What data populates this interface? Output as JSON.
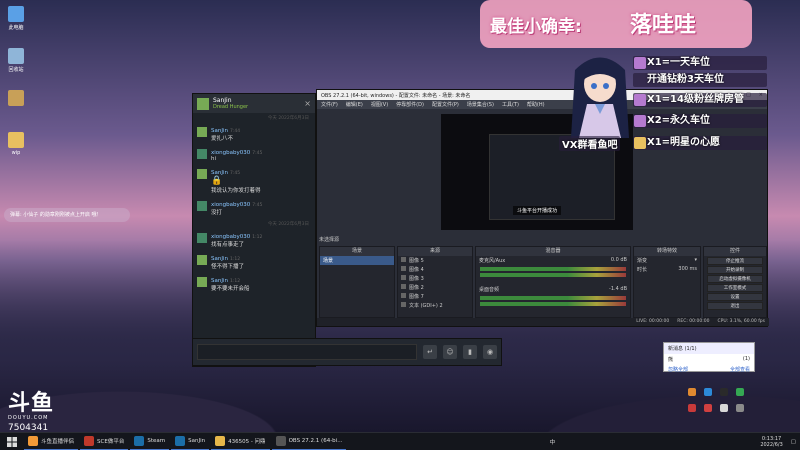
{
  "desktop": {
    "icons": [
      {
        "label": "此电脑",
        "color": "#5aa0e6"
      },
      {
        "label": "回收站",
        "color": "#8fb5d8"
      },
      {
        "label": "",
        "color": "#c8a058"
      },
      {
        "label": "wip",
        "color": "#e8c060"
      }
    ],
    "bubble_text": "弹幕: 小仙子 的勋章刚刚被点上开启 哦！"
  },
  "douyu": {
    "logo": "斗鱼",
    "sub": "DOUYU.COM",
    "room_number": "7504341"
  },
  "steam_chat": {
    "name": "SanJin",
    "game": "Dread Hunger",
    "messages": [
      {
        "sep": "今天 2022年6月3日",
        "who": "SanJin",
        "time": "7:44",
        "text": "爱扎八不",
        "color": "#7a5"
      },
      {
        "who": "xiongbaby030",
        "time": "7:45",
        "text": "hi",
        "color": "#486"
      },
      {
        "who": "SanJin",
        "time": "7:45",
        "text": "🔒",
        "color": "#7a5"
      },
      {
        "who": "",
        "time": "",
        "text": "我说认为你发打着得",
        "color": "#7a5"
      },
      {
        "who": "xiongbaby030",
        "time": "7:45",
        "text": "没打",
        "color": "#486"
      },
      {
        "sep": "今天 2022年6月3日",
        "who": "xiongbaby030",
        "time": "1:12",
        "text": "找有点事走了",
        "color": "#486"
      },
      {
        "who": "SanJin",
        "time": "1:12",
        "text": "怪不得下播了",
        "color": "#7a5"
      },
      {
        "who": "SanJin",
        "time": "1:12",
        "text": "要不要未开会船",
        "color": "#7a5"
      }
    ]
  },
  "obs": {
    "title": "OBS 27.2.1 (64-bit, windows) - 配置文件: 未命名 - 场景: 未命名",
    "menu": [
      "文件(F)",
      "编辑(E)",
      "视图(V)",
      "停靠部件(D)",
      "配置文件(P)",
      "场景集合(S)",
      "工具(T)",
      "帮助(H)"
    ],
    "preview_caption": "斗鱼平台开播成功",
    "panels_label": "未选择源",
    "scenes": {
      "title": "场景",
      "items": [
        "场景"
      ]
    },
    "sources": {
      "title": "来源",
      "items": [
        "图像 5",
        "图像 4",
        "图像 3",
        "图像 2",
        "图像 7",
        "文本 (GDI+) 2"
      ]
    },
    "mixer": {
      "title": "混音器",
      "tracks": [
        {
          "name": "麦克风/Aux",
          "db": "0.0 dB"
        },
        {
          "name": "桌面音频",
          "db": "-1.4 dB"
        }
      ]
    },
    "transitions": {
      "title": "转场特效",
      "type": "渐变",
      "duration_label": "时长",
      "duration": "300 ms"
    },
    "controls": {
      "title": "控件",
      "buttons": [
        "停止推流",
        "开始录制",
        "启动虚拟摄像机",
        "工作室模式",
        "设置",
        "退出"
      ]
    },
    "status": [
      "LIVE: 00:00:00",
      "REC: 00:00:00",
      "CPU: 3.1%, 60.00 fps"
    ]
  },
  "overlay": {
    "banner_text": "最佳小确幸:",
    "banner_name": "落哇哇",
    "ranks": [
      "X1=一天车位",
      "开通钻粉3天车位",
      "X1=14级粉丝牌房管",
      "X2=永久车位",
      "X1=明星の心愿"
    ],
    "vx_text": "VX群看鱼吧"
  },
  "notification": {
    "title": "新消息 (1/1)",
    "item": "熊",
    "count": "(1)",
    "footer_left": "忽略全部",
    "footer_right": "全部查看"
  },
  "taskbar": {
    "items": [
      {
        "label": "斗鱼直播伴侣",
        "color": "#f29a38"
      },
      {
        "label": "SCE做平台",
        "color": "#c0392b"
      },
      {
        "label": "Steam",
        "color": "#1b6ea8"
      },
      {
        "label": "SanJin",
        "color": "#1b6ea8"
      },
      {
        "label": "436505 - 问鼎",
        "color": "#e6b74a"
      },
      {
        "label": "OBS 27.2.1 (64-bi...",
        "color": "#555"
      }
    ],
    "time": "0:13:17",
    "date": "2022/6/3",
    "ime": "中"
  }
}
